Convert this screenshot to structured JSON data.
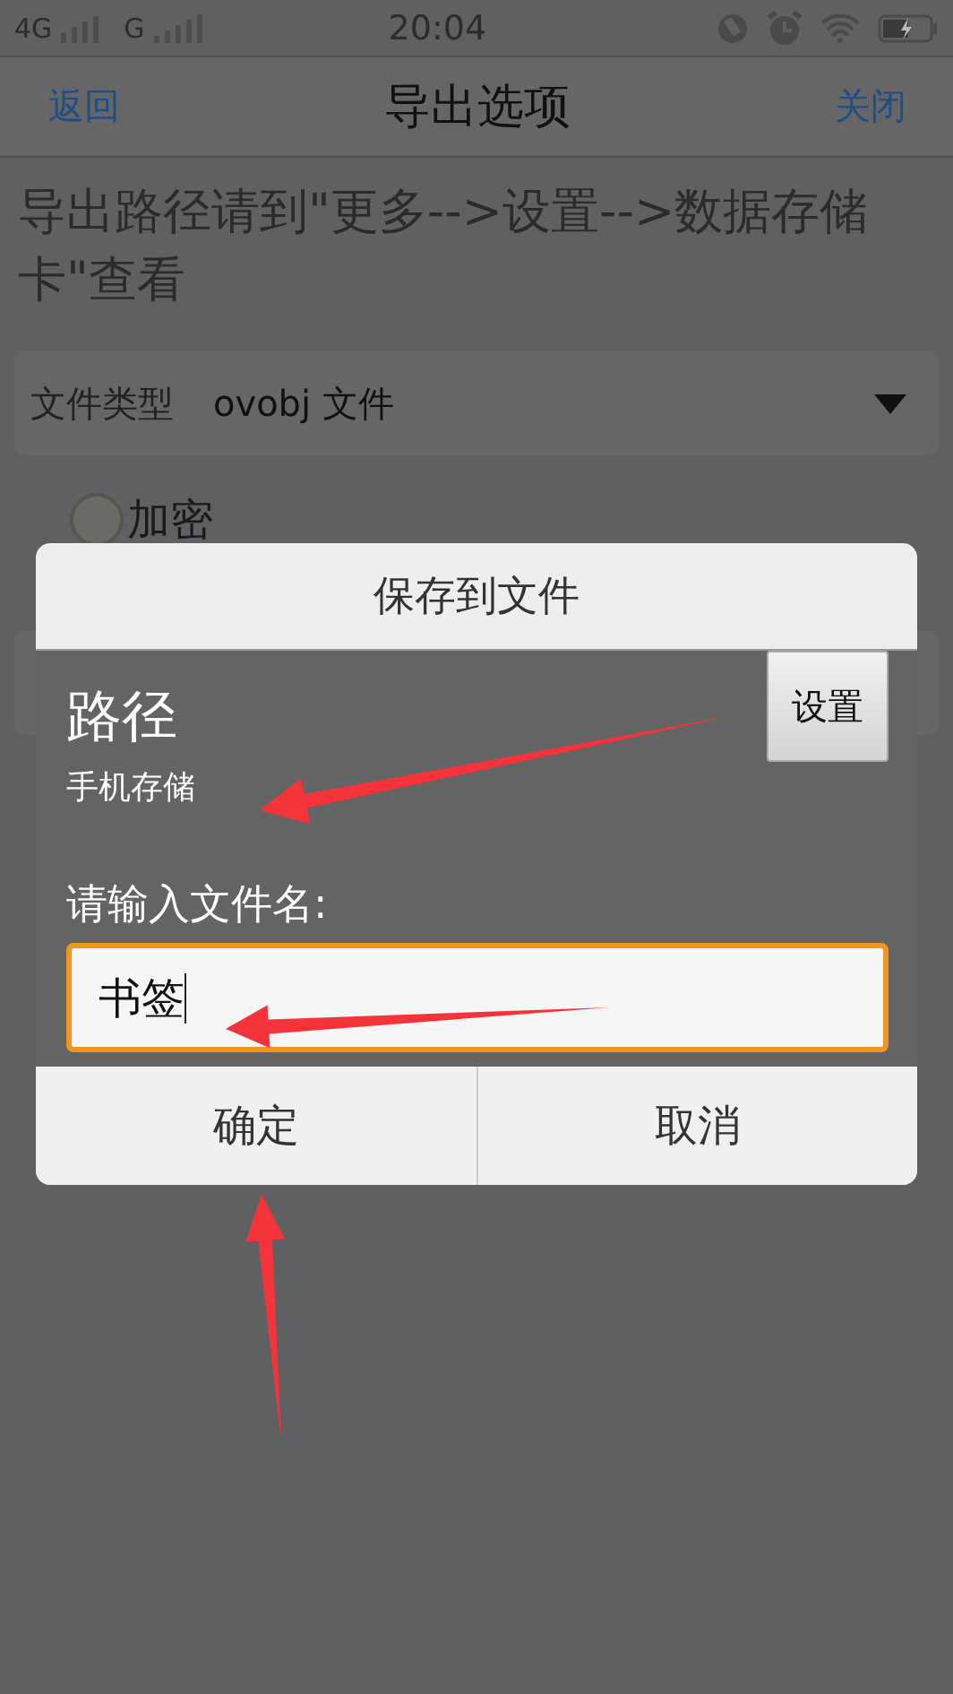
{
  "status_bar": {
    "network_1": "4G",
    "network_2": "G",
    "time": "20:04"
  },
  "nav_bar": {
    "back": "返回",
    "title": "导出选项",
    "close": "关闭"
  },
  "hint": "导出路径请到\"更多-->设置-->数据存储卡\"查看",
  "file_type": {
    "label": "文件类型",
    "value": "ovobj 文件"
  },
  "encrypt": {
    "label": "加密",
    "checked": false
  },
  "dialog": {
    "title": "保存到文件",
    "path_label": "路径",
    "settings_button": "设置",
    "path_value": "手机存储",
    "filename_label": "请输入文件名:",
    "filename_value": "书签",
    "focused": true,
    "buttons": [
      {
        "label": "确定"
      },
      {
        "label": "取消"
      }
    ]
  }
}
